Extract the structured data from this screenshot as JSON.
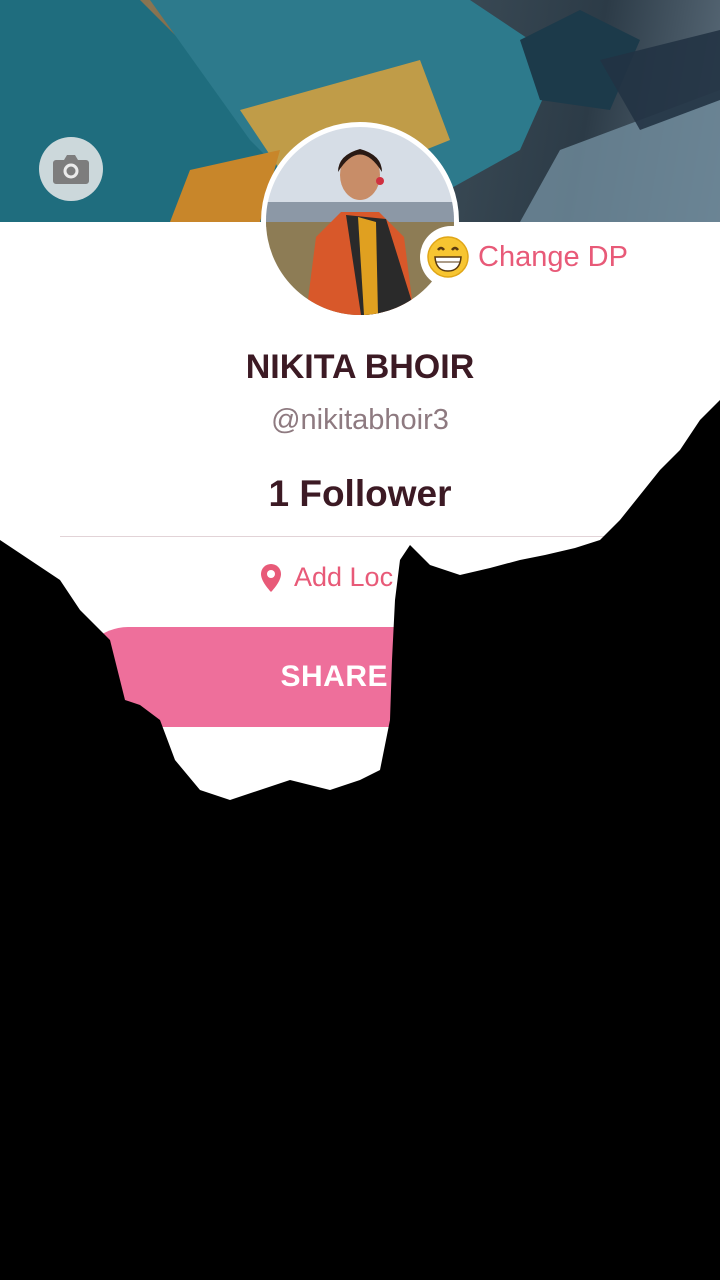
{
  "profile": {
    "change_dp_label": "Change DP",
    "name": "NIKITA BHOIR",
    "handle": "@nikitabhoir3",
    "followers": "1 Follower",
    "location_label": "Add Loc",
    "share_label": "SHARE PR"
  },
  "icons": {
    "camera": "camera-icon",
    "emoji": "grinning-face-icon",
    "location": "location-pin-icon"
  },
  "colors": {
    "accent": "#e85a78",
    "button": "#ee6f9b",
    "name_text": "#3c1a24",
    "overlay": "#000000"
  }
}
